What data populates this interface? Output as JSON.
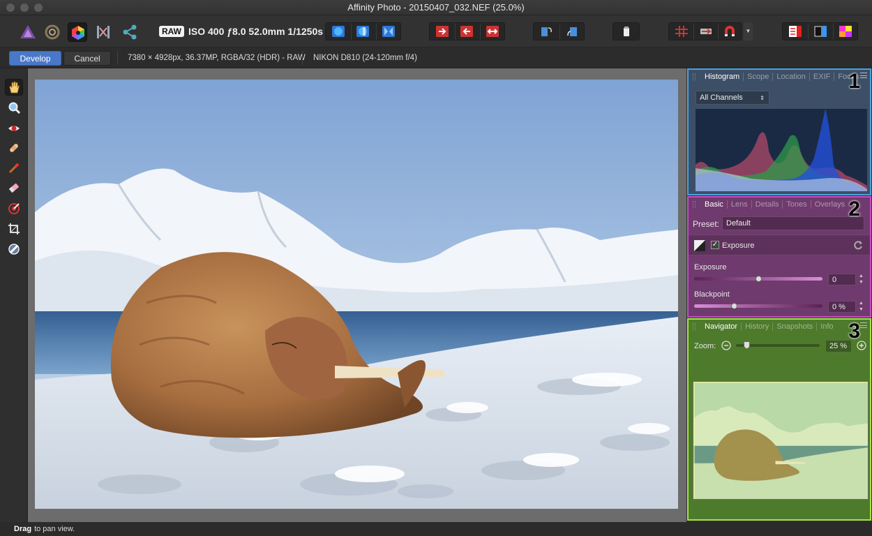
{
  "window": {
    "title": "Affinity Photo - 20150407_032.NEF (25.0%)"
  },
  "toolbar": {
    "raw_badge": "RAW",
    "exif_summary": "ISO 400 ƒ8.0 52.0mm 1/1250s",
    "personas": [
      "photo-persona",
      "liquify-persona",
      "develop-persona",
      "tone-mapping-persona",
      "export-persona"
    ]
  },
  "context": {
    "develop_label": "Develop",
    "cancel_label": "Cancel",
    "image_info": "7380 × 4928px, 36.37MP, RGBA/32 (HDR) - RAW",
    "camera_info": "NIKON D810 (24-120mm f/4)"
  },
  "tools": [
    "hand-tool",
    "zoom-tool",
    "red-eye-tool",
    "blemish-removal-tool",
    "overlay-paint-tool",
    "overlay-erase-tool",
    "overlay-gradient-tool",
    "crop-tool",
    "white-balance-tool"
  ],
  "panel1": {
    "number": "1",
    "tabs": [
      "Histogram",
      "Scope",
      "Location",
      "EXIF",
      "Focus"
    ],
    "selected_tab": "Histogram",
    "channels": "All Channels",
    "color": "#4aa3e0"
  },
  "panel2": {
    "number": "2",
    "tabs": [
      "Basic",
      "Lens",
      "Details",
      "Tones",
      "Overlays"
    ],
    "selected_tab": "Basic",
    "preset_label": "Preset:",
    "preset_value": "Default",
    "section_label": "Exposure",
    "exposure_label": "Exposure",
    "exposure_value": "0",
    "exposure_level": 0.5,
    "blackpoint_label": "Blackpoint",
    "blackpoint_value": "0 %",
    "blackpoint_level": 0.3,
    "color": "#c34fc4"
  },
  "panel3": {
    "number": "3",
    "tabs": [
      "Navigator",
      "History",
      "Snapshots",
      "Info"
    ],
    "selected_tab": "Navigator",
    "zoom_label": "Zoom:",
    "zoom_value": "25 %",
    "zoom_level": 0.1,
    "color": "#a5e34a"
  },
  "status": {
    "bold": "Drag",
    "text": "to pan view."
  }
}
